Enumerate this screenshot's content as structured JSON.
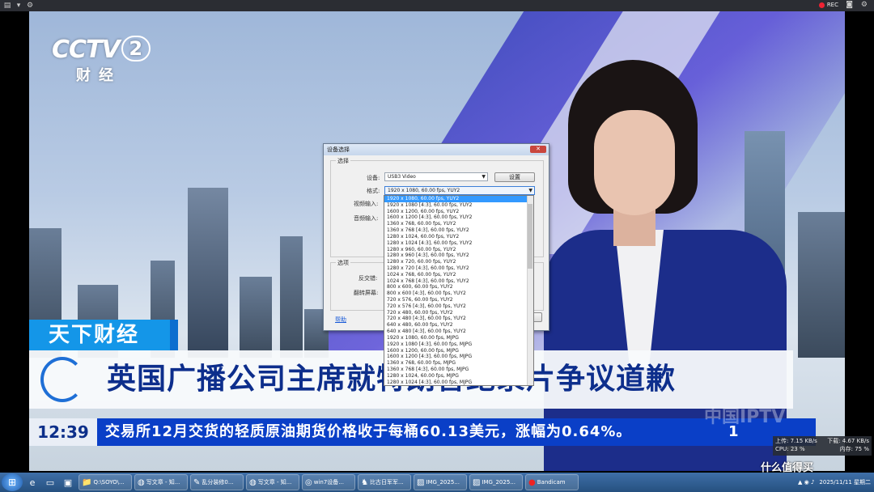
{
  "capture_toolbar": {
    "rec_label": "REC"
  },
  "channel_logo": {
    "main": "CCTV",
    "number": "2",
    "sub": "财经"
  },
  "lower_third": {
    "program_tag": "天下财经",
    "headline": "英国广播公司主席就特朗普纪录片争议道歉",
    "clock": "12:39",
    "ticker": "交易所12月交货的轻质原油期货价格收于每桶60.13美元，涨幅为0.64%。",
    "ticker_right": "1",
    "watermark": "中国IPTV"
  },
  "net_meter": {
    "up": "上传: 7.15 KB/s",
    "down": "下载: 4.67 KB/s",
    "cpu": "CPU: 23 %",
    "mem": "内存: 75 %"
  },
  "dialog": {
    "title": "设备选择",
    "group1_legend": "选择",
    "device_label": "设备:",
    "device_value": "USB3 Video",
    "device_settings_button": "设置",
    "format_label": "格式:",
    "format_value": "1920 x 1080, 60.00 fps, YUY2",
    "video_input_label": "视频输入:",
    "audio_input_label": "音频输入:",
    "group2_legend": "选项",
    "option1_label": "反交错:",
    "option2_label": "翻转屏幕:",
    "help_link": "帮助"
  },
  "format_options": [
    "1920 x 1080, 60.00 fps, YUY2",
    "1920 x 1080 [4:3], 60.00 fps, YUY2",
    "1600 x 1200, 60.00 fps, YUY2",
    "1600 x 1200 [4:3], 60.00 fps, YUY2",
    "1360 x 768, 60.00 fps, YUY2",
    "1360 x 768 [4:3], 60.00 fps, YUY2",
    "1280 x 1024, 60.00 fps, YUY2",
    "1280 x 1024 [4:3], 60.00 fps, YUY2",
    "1280 x 960, 60.00 fps, YUY2",
    "1280 x 960 [4:3], 60.00 fps, YUY2",
    "1280 x 720, 60.00 fps, YUY2",
    "1280 x 720 [4:3], 60.00 fps, YUY2",
    "1024 x 768, 60.00 fps, YUY2",
    "1024 x 768 [4:3], 60.00 fps, YUY2",
    "800 x 600, 60.00 fps, YUY2",
    "800 x 600 [4:3], 60.00 fps, YUY2",
    "720 x 576, 60.00 fps, YUY2",
    "720 x 576 [4:3], 60.00 fps, YUY2",
    "720 x 480, 60.00 fps, YUY2",
    "720 x 480 [4:3], 60.00 fps, YUY2",
    "640 x 480, 60.00 fps, YUY2",
    "640 x 480 [4:3], 60.00 fps, YUY2",
    "1920 x 1080, 60.00 fps, MJPG",
    "1920 x 1080 [4:3], 60.00 fps, MJPG",
    "1600 x 1200, 60.00 fps, MJPG",
    "1600 x 1200 [4:3], 60.00 fps, MJPG",
    "1360 x 768, 60.00 fps, MJPG",
    "1360 x 768 [4:3], 60.00 fps, MJPG",
    "1280 x 1024, 60.00 fps, MJPG",
    "1280 x 1024 [4:3], 60.00 fps, MJPG"
  ],
  "selected_format_index": 0,
  "taskbar": {
    "tasks": [
      {
        "label": "Q:\\SOYO\\...",
        "icon": "folder-icon"
      },
      {
        "label": "写文章 - 知...",
        "icon": "chrome-icon"
      },
      {
        "label": "乱分装修0...",
        "icon": "note-icon"
      },
      {
        "label": "写文章 - 知...",
        "icon": "chrome-icon"
      },
      {
        "label": "win7设备...",
        "icon": "firefox-icon"
      },
      {
        "label": "比古日军军...",
        "icon": "game-icon"
      },
      {
        "label": "IMG_2025...",
        "icon": "image-icon"
      },
      {
        "label": "IMG_2025...",
        "icon": "image-icon"
      },
      {
        "label": "Bandicam",
        "icon": "record-icon"
      }
    ],
    "date": "2025/11/11 星期二",
    "brand": "什么值得买"
  }
}
